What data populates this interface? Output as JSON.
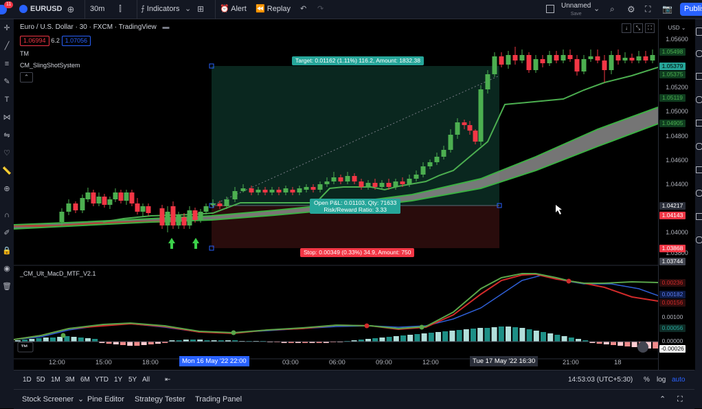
{
  "topbar": {
    "notif_count": "11",
    "symbol": "EURUSD",
    "interval": "30m",
    "indicators_label": "Indicators",
    "alert_label": "Alert",
    "replay_label": "Replay",
    "layout_name": "Unnamed",
    "layout_status": "Save",
    "publish_label": "Publish"
  },
  "chart": {
    "title": "Euro / U.S. Dollar · 30 · FXCM · TradingView",
    "bid": "1.06994",
    "spread": "6.2",
    "ask": "1.07056",
    "study1": "TM",
    "study2": "CM_SlingShotSystem",
    "study3": "_CM_Ult_MacD_MTF_V2.1",
    "currency": "USD",
    "colors": {
      "up": "#4caf50",
      "down": "#f23645",
      "target_zone": "#0b2b22",
      "stop_zone": "#2e0d0d",
      "macd_fast": "#5aa64a",
      "macd_slow": "#2f5fd6",
      "macd_red": "#d12a2a"
    }
  },
  "position": {
    "target": "Target: 0.01162 (1.11%) 116.2, Amount: 1832.38",
    "open_pnl": "Open P&L: 0.01103, Qty: 71633",
    "risk_reward": "Risk/Reward Ratio: 3.33",
    "stop": "Stop: 0.00349 (0.33%) 34.9, Amount: 750"
  },
  "price_scale": {
    "ticks": [
      "1.05600",
      "1.05200",
      "1.04800",
      "1.04600",
      "1.04400",
      "1.04000",
      "1.03800"
    ],
    "ticks2": [
      "1.05000",
      "1.04200"
    ],
    "tags": [
      {
        "v": "1.05498",
        "bg": "#0f3d1f",
        "fg": "#4caf50"
      },
      {
        "v": "1.05379",
        "bg": "#26a69a",
        "fg": "#000"
      },
      {
        "v": "1.05375",
        "bg": "#0f3d1f",
        "fg": "#4caf50"
      },
      {
        "v": "1.05119",
        "bg": "#0f3d1f",
        "fg": "#4caf50"
      },
      {
        "v": "1.04905",
        "bg": "#0f3d1f",
        "fg": "#4caf50"
      },
      {
        "v": "1.04217",
        "bg": "#2a2e39",
        "fg": "#fff"
      },
      {
        "v": "1.04143",
        "bg": "#f23645",
        "fg": "#fff"
      },
      {
        "v": "1.03868",
        "bg": "#f23645",
        "fg": "#fff"
      },
      {
        "v": "1.03744",
        "bg": "#434651",
        "fg": "#fff"
      }
    ],
    "macd_tags": [
      {
        "v": "0.00236",
        "bg": "#2e0d0d",
        "fg": "#d12a2a"
      },
      {
        "v": "0.00182",
        "bg": "#0e1b44",
        "fg": "#5b7cf5"
      },
      {
        "v": "0.00156",
        "bg": "#2e0d0d",
        "fg": "#d12a2a"
      },
      {
        "v": "0.00100",
        "bg": "none",
        "fg": "#b2b5be"
      },
      {
        "v": "0.00056",
        "bg": "#0e2b26",
        "fg": "#26a69a"
      },
      {
        "v": "0.00000",
        "bg": "none",
        "fg": "#b2b5be"
      },
      {
        "v": "-0.00026",
        "bg": "#fff",
        "fg": "#000"
      }
    ]
  },
  "time_axis": {
    "labels": [
      "12:00",
      "15:00",
      "18:00",
      "7",
      "03:00",
      "06:00",
      "09:00",
      "12:00",
      "21:00",
      "18"
    ],
    "highlight1": "Mon 16 May '22   22:00",
    "highlight2": "Tue 17 May '22   16:30"
  },
  "bottombar": {
    "ranges": [
      "1D",
      "5D",
      "1M",
      "3M",
      "6M",
      "YTD",
      "1Y",
      "5Y",
      "All"
    ],
    "clock": "14:53:03 (UTC+5:30)",
    "percent": "%",
    "log": "log",
    "auto": "auto"
  },
  "panels": {
    "stock_screener": "Stock Screener",
    "pine_editor": "Pine Editor",
    "strategy_tester": "Strategy Tester",
    "trading_panel": "Trading Panel"
  }
}
